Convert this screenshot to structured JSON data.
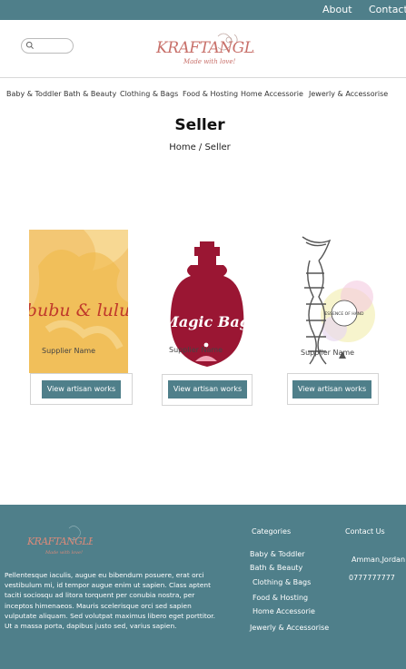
{
  "topbar": {
    "about": "About",
    "contact": "Contact"
  },
  "logo": {
    "name": "KRAFTANGLE",
    "tagline": "Made with love!"
  },
  "nav": [
    "Baby & Toddler",
    "Bath & Beauty",
    "Clothing & Bags",
    "Food & Hosting",
    "Home Accessorie",
    "Jewerly & Accessorise"
  ],
  "page": {
    "title": "Seller",
    "breadcrumb": "Home / Seller"
  },
  "cards": [
    {
      "image_text": "bubu & lulu",
      "label": "Supplier Name",
      "button": "View artisan works"
    },
    {
      "image_text": "Magic Bag",
      "label": "Supplier Name",
      "button": "View artisan works"
    },
    {
      "image_text": "ESSENCE OF HAND",
      "label": "Supplier Name",
      "button": "View artisan works"
    }
  ],
  "footer": {
    "description": "Pellentesque iaculis, augue eu bibendum posuere, erat orci vestibulum mi, id tempor augue enim ut sapien. Class aptent taciti sociosqu ad litora torquent per conubia nostra, per inceptos himenaeos. Mauris scelerisque orci sed sapien vulputate aliquam. Sed volutpat maximus libero eget porttitor. Ut a massa porta, dapibus justo sed, varius sapien.",
    "categories_heading": "Categories",
    "categories": [
      "Baby & Toddler",
      "Bath & Beauty",
      "Clothing & Bags",
      "Food & Hosting",
      "Home Accessorie",
      "Jewerly & Accessorise"
    ],
    "contact_heading": "Contact Us",
    "location": "Amman,Jordan",
    "phone": "0777777777"
  },
  "colors": {
    "brand": "#4f7f8a",
    "logo_accent": "#c8706a"
  }
}
